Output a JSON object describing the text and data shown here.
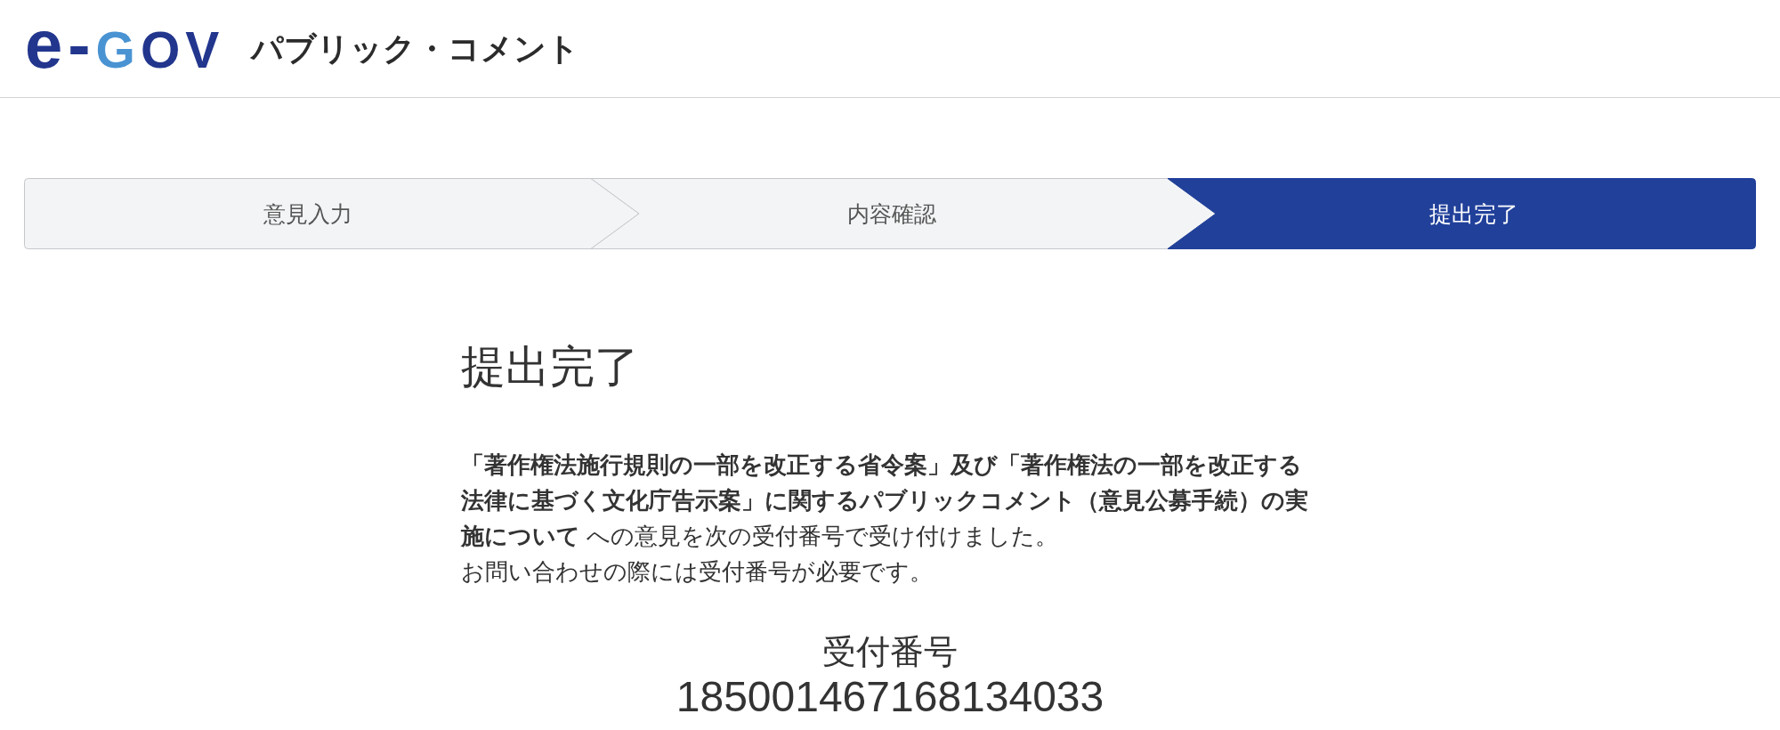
{
  "header": {
    "logo": {
      "parts": [
        {
          "text": "e-",
          "color": "#22368e"
        },
        {
          "text": "G",
          "color": "#4a93d3"
        },
        {
          "text": "OV",
          "color": "#22368e"
        }
      ]
    },
    "title": "パブリック・コメント"
  },
  "steps": [
    {
      "label": "意見入力",
      "selected": false
    },
    {
      "label": "内容確認",
      "selected": false
    },
    {
      "label": "提出完了",
      "selected": true
    }
  ],
  "main": {
    "heading": "提出完了",
    "message": "**「著作権法施行規則の一部を改正する省令案」及び「著作権法の一部を改正する法律に基づく文化庁告示案」に関するパブリックコメント（意見公募手続）の実施について** への意見を次の受付番号で受け付けました。",
    "note": "お問い合わせの際には受付番号が必要です。",
    "receipt_label": "受付番号",
    "receipt_number": "185001467168134033"
  }
}
